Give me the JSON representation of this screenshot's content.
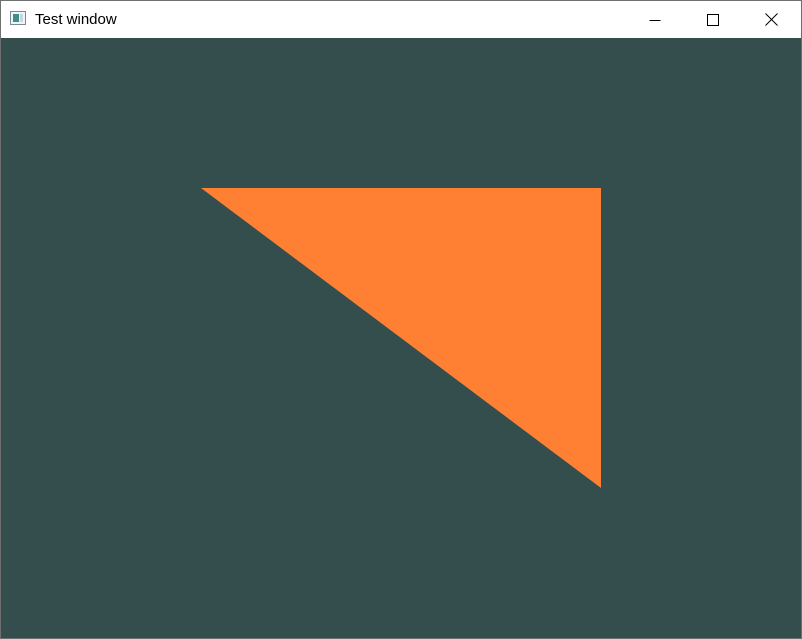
{
  "window": {
    "title": "Test window",
    "controls": {
      "minimize": "minimize-icon",
      "maximize": "maximize-icon",
      "close": "close-icon"
    }
  },
  "canvas": {
    "background_color": "#344d4d",
    "shape": {
      "type": "triangle",
      "fill_color": "#ff8033"
    }
  }
}
